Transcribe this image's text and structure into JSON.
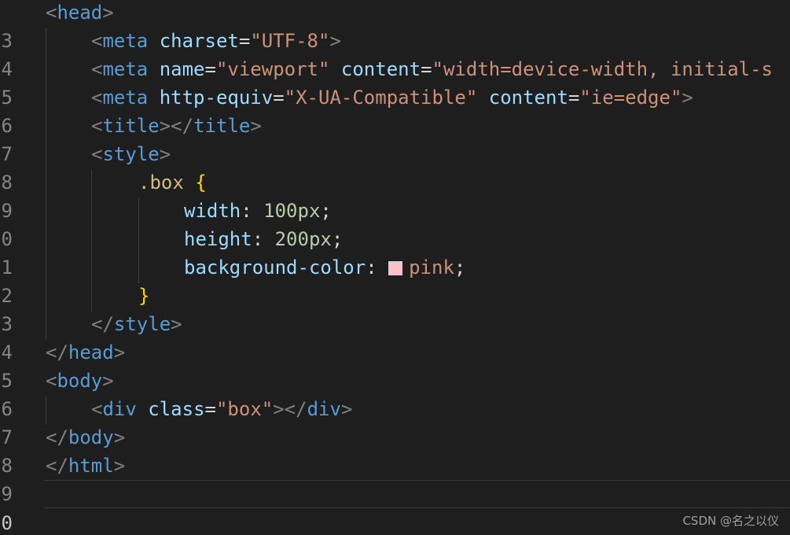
{
  "line_numbers": [
    "3",
    "4",
    "5",
    "6",
    "7",
    "8",
    "9",
    "0",
    "1",
    "2",
    "3",
    "4",
    "5",
    "6",
    "7",
    "8",
    "9",
    "0"
  ],
  "code": {
    "l3": [
      "<",
      "head",
      ">"
    ],
    "l4": [
      "<",
      "meta",
      " ",
      "charset",
      "=",
      "\"UTF-8\"",
      ">"
    ],
    "l5": [
      "<",
      "meta",
      " ",
      "name",
      "=",
      "\"viewport\"",
      " ",
      "content",
      "=",
      "\"width=device-width, initial-s"
    ],
    "l6": [
      "<",
      "meta",
      " ",
      "http-equiv",
      "=",
      "\"X-UA-Compatible\"",
      " ",
      "content",
      "=",
      "\"ie=edge\"",
      ">"
    ],
    "l7": [
      "<",
      "title",
      "></",
      "title",
      ">"
    ],
    "l8": [
      "<",
      "style",
      ">"
    ],
    "l9": [
      ".box",
      " ",
      "{"
    ],
    "l10": [
      "width",
      ": ",
      "100px",
      ";"
    ],
    "l11": [
      "height",
      ": ",
      "200px",
      ";"
    ],
    "l12": [
      "background-color",
      ": ",
      "pink",
      ";"
    ],
    "l13": [
      "}"
    ],
    "l14": [
      "</",
      "style",
      ">"
    ],
    "l15": [
      "</",
      "head",
      ">"
    ],
    "l16": [
      "<",
      "body",
      ">"
    ],
    "l17": [
      "<",
      "div",
      " ",
      "class",
      "=",
      "\"box\"",
      "></",
      "div",
      ">"
    ],
    "l18": [
      "</",
      "body",
      ">"
    ],
    "l19": [
      "</",
      "html",
      ">"
    ]
  },
  "swatch_color": "#ffc0cb",
  "watermark": "CSDN @名之以仪"
}
